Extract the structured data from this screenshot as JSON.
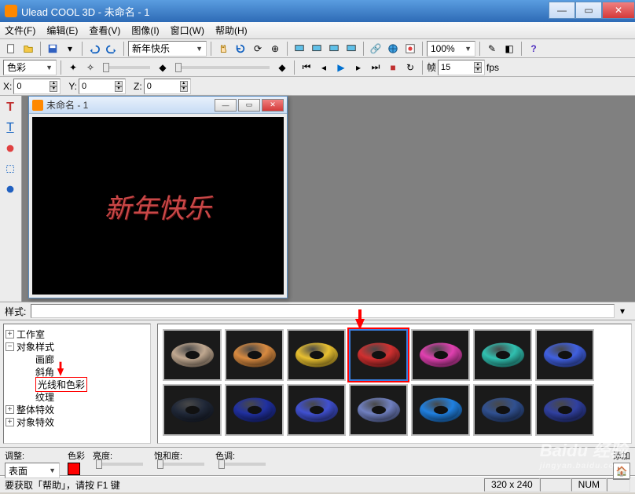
{
  "app": {
    "title": "Ulead COOL 3D - 未命名 - 1"
  },
  "menu": {
    "file": "文件(F)",
    "edit": "编辑(E)",
    "view": "查看(V)",
    "image": "图像(I)",
    "window": "窗口(W)",
    "help": "帮助(H)"
  },
  "toolbar1": {
    "text_combo": "新年快乐",
    "zoom": "100%"
  },
  "toolbar2": {
    "mode_combo": "色彩",
    "frame_label": "帧",
    "frame_value": "15",
    "fps": "fps"
  },
  "coords": {
    "x_label": "X:",
    "x": "0",
    "y_label": "Y:",
    "y": "0",
    "z_label": "Z:",
    "z": "0"
  },
  "doc": {
    "title": "未命名 - 1",
    "canvas_text": "新年快乐"
  },
  "stylerow": {
    "label": "样式:"
  },
  "tree": {
    "n0": "工作室",
    "n1": "对象样式",
    "n1a": "画廊",
    "n1b": "斜角",
    "n1c": "光线和色彩",
    "n1d": "纹理",
    "n2": "整体特效",
    "n3": "对象特效"
  },
  "thumbs": {
    "colors_row1": [
      "#c0a890",
      "#d88a40",
      "#e8c030",
      "#d03030",
      "#e040b0",
      "#30c0b0",
      "#4060e0"
    ],
    "colors_row2": [
      "#202838",
      "#2030a0",
      "#4050d0",
      "#7080c0",
      "#2080e0",
      "#305090",
      "#3040a0"
    ],
    "selected_index": 3
  },
  "adjust": {
    "title": "调整:",
    "surface_label": "表面",
    "color_label": "色彩",
    "bright_label": "亮度:",
    "sat_label": "饱和度:",
    "hue_label": "色调:",
    "add_label": "添加"
  },
  "status": {
    "help": "要获取「帮助」，请按 F1 键",
    "dim": "320 x 240",
    "num": "NUM"
  },
  "watermark": {
    "brand": "Baidu 经验",
    "url": "jingyan.baidu.com"
  },
  "icons": {
    "new": "new-icon",
    "open": "open-icon",
    "save": "save-icon",
    "undo": "undo-icon",
    "redo": "redo-icon",
    "hand": "hand-icon",
    "rotate": "rotate-icon",
    "globe": "globe-icon",
    "help": "help-icon",
    "play": "play-icon"
  }
}
